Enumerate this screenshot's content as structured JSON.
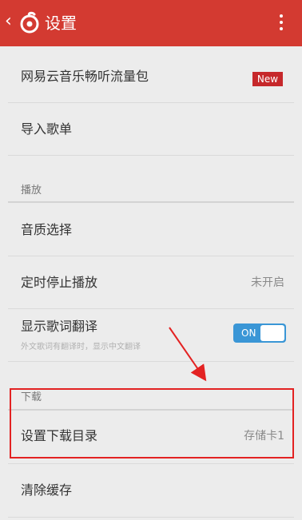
{
  "header": {
    "back_glyph": "‹",
    "title": "设置"
  },
  "items": {
    "traffic_pack": {
      "label": "网易云音乐畅听流量包",
      "badge": "New"
    },
    "import_playlist": {
      "label": "导入歌单"
    },
    "section_playback": "播放",
    "sound_quality": {
      "label": "音质选择"
    },
    "sleep_timer": {
      "label": "定时停止播放",
      "value": "未开启"
    },
    "lyrics_translation": {
      "label": "显示歌词翻译",
      "hint": "外文歌词有翻译时，显示中文翻译",
      "toggle_label": "ON"
    },
    "section_download": "下载",
    "download_dir": {
      "label": "设置下载目录",
      "value": "存储卡1"
    },
    "clear_cache": {
      "label": "清除缓存"
    }
  },
  "colors": {
    "header_bg": "#d33a31",
    "badge_bg": "#c6282b",
    "toggle_on": "#3a96d6",
    "annotation_red": "#e32222"
  },
  "icons": {
    "back": "chevron-left-icon",
    "logo": "netease-music-logo-icon",
    "more": "more-vertical-icon"
  }
}
